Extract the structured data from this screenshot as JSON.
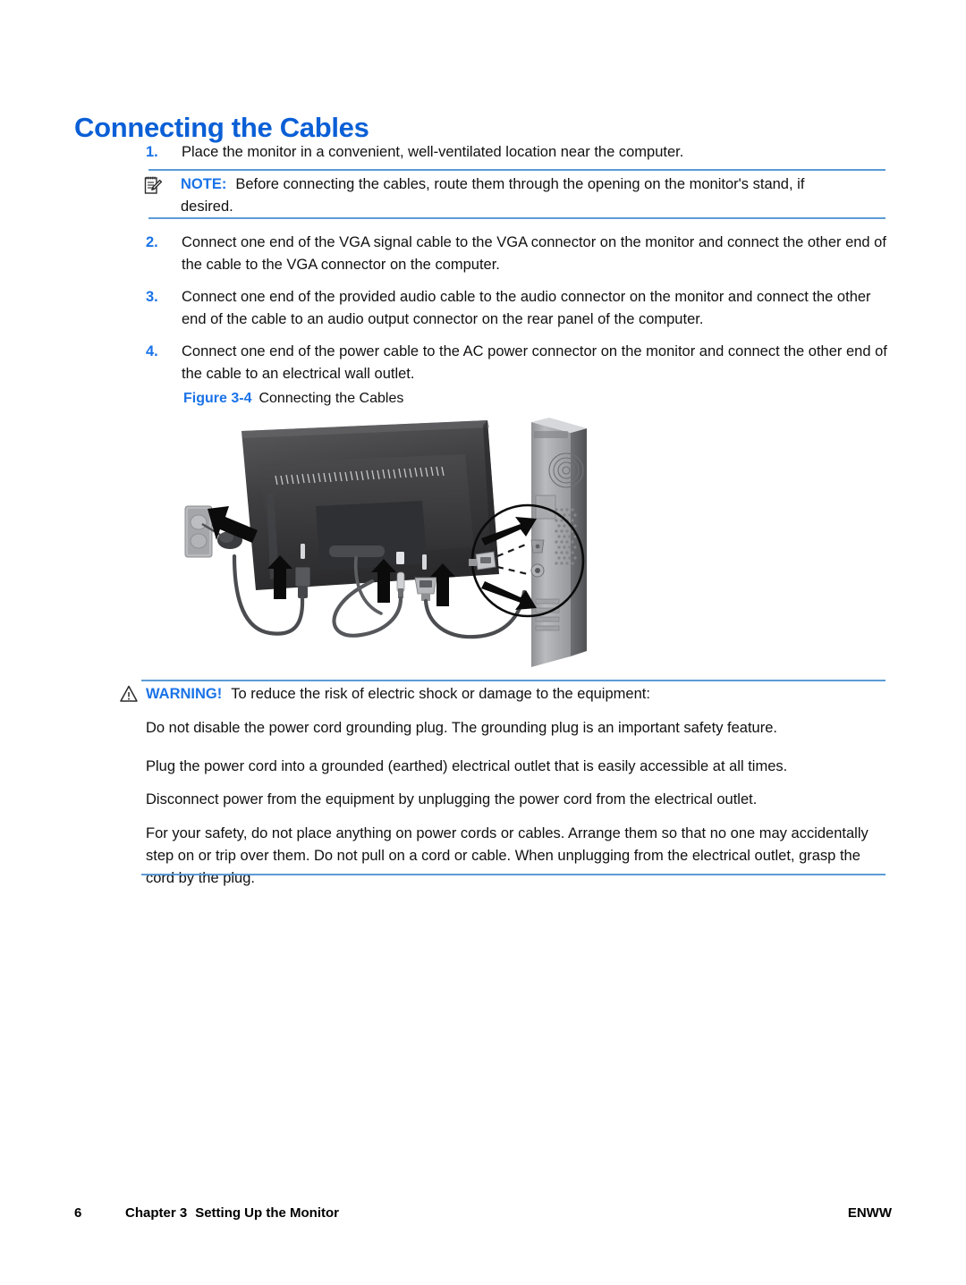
{
  "document": {
    "title": "Connecting the Cables"
  },
  "steps": [
    {
      "num": "1.",
      "text": "Place the monitor in a convenient, well-ventilated location near the computer."
    },
    {
      "num": "2.",
      "text": "Connect one end of the VGA signal cable to the VGA connector on the monitor and connect the other end of the cable to the VGA connector on the computer."
    },
    {
      "num": "3.",
      "text": "Connect one end of the provided audio cable to the audio connector on the monitor and connect the other end of the cable to an audio output connector on the rear panel of the computer."
    },
    {
      "num": "4.",
      "text": "Connect one end of the power cable to the AC power connector on the monitor and connect the other end of the cable to an electrical wall outlet."
    }
  ],
  "note": {
    "label": "NOTE:",
    "text_line_1": "Before connecting the cables, route them through the opening on the monitor's stand, if",
    "text_line_2": "desired.",
    "icon": "note-pencil-icon"
  },
  "figure": {
    "label": "Figure 3-4",
    "title": "Connecting the Cables",
    "illustration": "monitor-rear-cable-connection-diagram"
  },
  "warning": {
    "label": "WARNING!",
    "icon": "warning-triangle-icon",
    "intro": "To reduce the risk of electric shock or damage to the equipment:",
    "paragraphs": [
      "Do not disable the power cord grounding plug. The grounding plug is an important safety feature.",
      "Plug the power cord into a grounded (earthed) electrical outlet that is easily accessible at all times.",
      "Disconnect power from the equipment by unplugging the power cord from the electrical outlet.",
      "For your safety, do not place anything on power cords or cables. Arrange them so that no one may",
      "accidentally step on or trip over them. Do not pull on a cord or cable. When unplugging from the electrical",
      "outlet, grasp the cord by the plug."
    ]
  },
  "footer": {
    "page_number": "6",
    "chapter": "Chapter 3",
    "chapter_title": "Setting Up the Monitor",
    "locale": "ENWW"
  },
  "colors": {
    "heading_blue": "#0a5fd6",
    "accent_blue": "#1a73e8",
    "rule_blue": "#5b9bd5",
    "body_black": "#111111"
  }
}
